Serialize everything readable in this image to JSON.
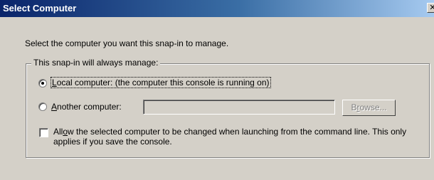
{
  "window": {
    "title": "Select Computer",
    "close_glyph": "✕"
  },
  "intro_text": "Select the computer you want this snap-in to manage.",
  "group": {
    "legend": "This snap-in will always manage:",
    "local": {
      "accel": "L",
      "label_rest": "ocal computer:  (the computer this console is running on)",
      "selected": true
    },
    "another": {
      "accel": "A",
      "label_rest": "nother computer:",
      "selected": false,
      "input_value": ""
    },
    "browse_button": {
      "pre": "B",
      "accel": "r",
      "post": "owse..."
    },
    "allow_change": {
      "pre": "All",
      "accel": "o",
      "post": "w the selected computer to be changed when launching from the command line.  This only applies if you save the console.",
      "checked": false
    }
  }
}
